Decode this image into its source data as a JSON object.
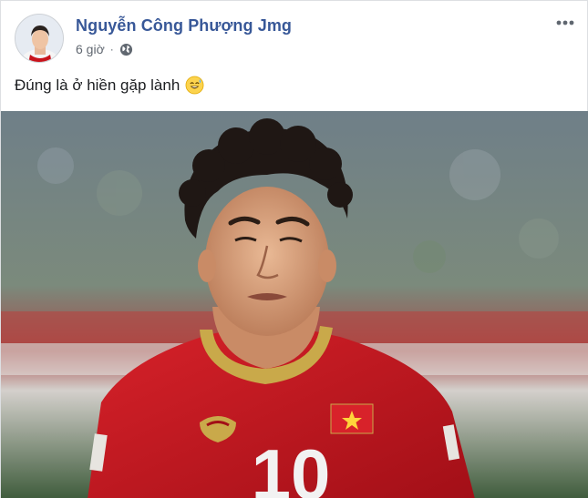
{
  "post": {
    "author_name": "Nguyễn Công Phượng Jmg",
    "timestamp": "6 giờ",
    "separator": "·",
    "privacy_icon": "globe-icon",
    "more_icon": "more-options-icon",
    "caption": "Đúng là ở hiền gặp lành",
    "caption_emoji": "sweat-smile-emoji",
    "photo": {
      "description_icon": "photo",
      "jersey_number": "10"
    }
  },
  "colors": {
    "author_link": "#385898",
    "meta_text": "#606770",
    "jersey_red": "#c8141c",
    "jersey_gold": "#c9a94a"
  }
}
